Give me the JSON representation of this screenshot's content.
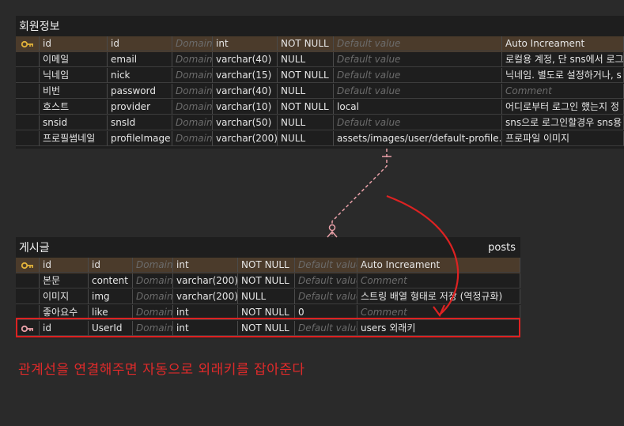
{
  "colors": {
    "accent_red": "#e02a2a",
    "pk_row": "#4b3b2b",
    "key_gold": "#e2b23a",
    "fk_key": "#e9a0a8"
  },
  "members": {
    "title": "회원정보",
    "rows": [
      {
        "pk": true,
        "name": "id",
        "col": "id",
        "domain": "Domain",
        "type": "int",
        "null": "NOT NULL",
        "default": "Default value",
        "default_ph": true,
        "comment": "Auto Increament",
        "comment_ph": false
      },
      {
        "pk": false,
        "name": "이메일",
        "col": "email",
        "domain": "Domain",
        "type": "varchar(40)",
        "null": "NULL",
        "default": "Default value",
        "default_ph": true,
        "comment": "로컬용 계정, 단 sns에서 로그",
        "comment_ph": false
      },
      {
        "pk": false,
        "name": "닉네임",
        "col": "nick",
        "domain": "Domain",
        "type": "varchar(15)",
        "null": "NOT NULL",
        "default": "Default value",
        "default_ph": true,
        "comment": "닉네임. 별도로 설정하거나, s",
        "comment_ph": false
      },
      {
        "pk": false,
        "name": "비번",
        "col": "password",
        "domain": "Domain",
        "type": "varchar(40)",
        "null": "NULL",
        "default": "Default value",
        "default_ph": true,
        "comment": "Comment",
        "comment_ph": true
      },
      {
        "pk": false,
        "name": "호스트",
        "col": "provider",
        "domain": "Domain",
        "type": "varchar(10)",
        "null": "NOT NULL",
        "default": "local",
        "default_ph": false,
        "comment": "어디로부터 로그인 했는지 정",
        "comment_ph": false
      },
      {
        "pk": false,
        "name": "snsid",
        "col": "snsId",
        "domain": "Domain",
        "type": "varchar(50)",
        "null": "NULL",
        "default": "Default value",
        "default_ph": true,
        "comment": "sns으로 로그인할경우 sns용",
        "comment_ph": false
      },
      {
        "pk": false,
        "name": "프로필썸네일",
        "col": "profileImage",
        "domain": "Domain",
        "type": "varchar(200)",
        "null": "NULL",
        "default": "assets/images/user/default-profile.jpg",
        "default_ph": false,
        "comment": "프로파일 이미지",
        "comment_ph": false
      }
    ]
  },
  "posts": {
    "title": "게시글",
    "table_name": "posts",
    "rows": [
      {
        "pk": true,
        "fk": false,
        "name": "id",
        "col": "id",
        "domain": "Domain",
        "type": "int",
        "null": "NOT NULL",
        "default": "Default value",
        "default_ph": true,
        "comment": "Auto Increament",
        "comment_ph": false
      },
      {
        "pk": false,
        "fk": false,
        "name": "본문",
        "col": "content",
        "domain": "Domain",
        "type": "varchar(200)",
        "null": "NOT NULL",
        "default": "Default value",
        "default_ph": true,
        "comment": "Comment",
        "comment_ph": true
      },
      {
        "pk": false,
        "fk": false,
        "name": "이미지",
        "col": "img",
        "domain": "Domain",
        "type": "varchar(200)",
        "null": "NULL",
        "default": "Default value",
        "default_ph": true,
        "comment": "스트링 배열 형태로 저장 (역정규화)",
        "comment_ph": false
      },
      {
        "pk": false,
        "fk": false,
        "name": "좋아요수",
        "col": "like",
        "domain": "Domain",
        "type": "int",
        "null": "NOT NULL",
        "default": "0",
        "default_ph": false,
        "comment": "Comment",
        "comment_ph": true
      },
      {
        "pk": false,
        "fk": true,
        "name": "id",
        "col": "UserId",
        "domain": "Domain",
        "type": "int",
        "null": "NOT NULL",
        "default": "Default value",
        "default_ph": true,
        "comment": "users 외래키",
        "comment_ph": false
      }
    ]
  },
  "annotation": "관계선을 연결해주면 자동으로 외래키를 잡아준다"
}
